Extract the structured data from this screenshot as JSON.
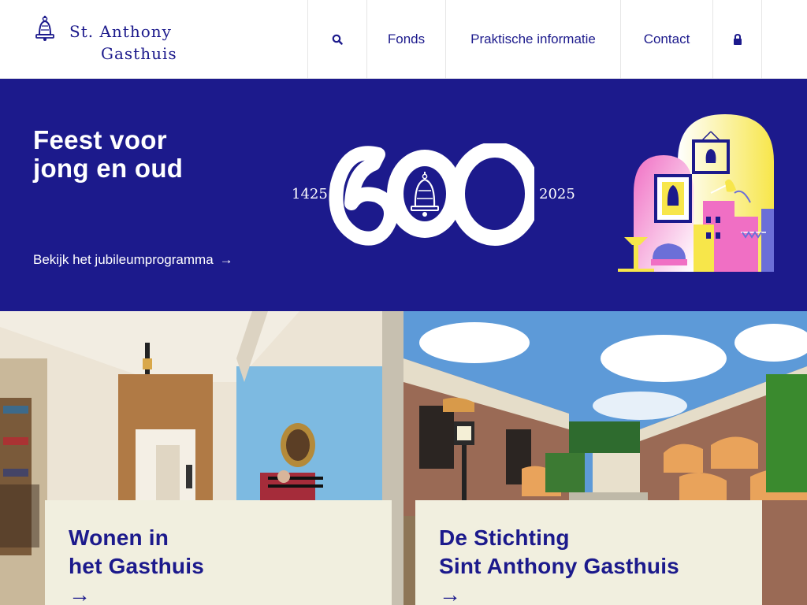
{
  "logo": {
    "line1": "St. Anthony",
    "line2": "Gasthuis"
  },
  "nav": {
    "search_icon": "search-icon",
    "items": [
      {
        "label": "Fonds"
      },
      {
        "label": "Praktische informatie"
      },
      {
        "label": "Contact"
      }
    ],
    "login_icon": "lock-icon"
  },
  "hero": {
    "title_line1": "Feest voor",
    "title_line2": "jong en oud",
    "link_label": "Bekijk het jubileumprogramma",
    "link_arrow": "→",
    "year_start": "1425",
    "year_end": "2025",
    "emblem_number": "600",
    "background": "#1c1a8c"
  },
  "cards": [
    {
      "title_line1": "Wonen in",
      "title_line2": "het Gasthuis",
      "arrow": "→"
    },
    {
      "title_line1": "De Stichting",
      "title_line2": "Sint Anthony Gasthuis",
      "arrow": "→"
    }
  ],
  "colors": {
    "brand": "#1c1a8c",
    "card_bg": "#f1efdf"
  }
}
